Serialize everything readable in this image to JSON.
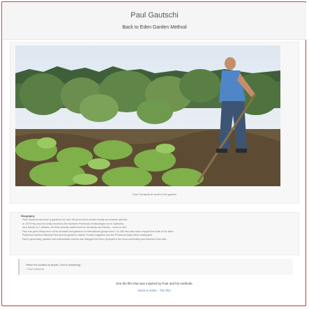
{
  "header": {
    "name": "Paul Gautschi",
    "back_link": "Back to Eden Garden Method"
  },
  "photo": {
    "caption": "Paul Gautschi at work in his garden"
  },
  "biography": {
    "title": "Biography",
    "items": [
      "Paul Gautschi has been a gardener for over 55 years and is known locally as a master arborist.",
      "In 1979 Paul and his family moved to the Northern Peninsula of Washington from California.",
      "As a farmer to 7 children, he feels primary raised food for his family and friends – never to sell.",
      "Paul has given lively tours of his orchards and gardens to international groups from 1 to 450 who also have enjoyed the fruits of his labor.",
      "Published articles featuring Paul and his gardens include Sunset magazine and the Peninsula Daily News newspaper.",
      "Paul's generosity, passion and enthusiastic outlook has changed the lives of people in the local community and travelers from afar."
    ]
  },
  "quote": {
    "text": "\"When the solution is simple, God is answering.\"",
    "attribution": "– Paul Gautschi"
  },
  "footer": {
    "film_text": "See the film that was inspired by Paul and his methods.",
    "film_link": "Back to Eden - The film"
  }
}
